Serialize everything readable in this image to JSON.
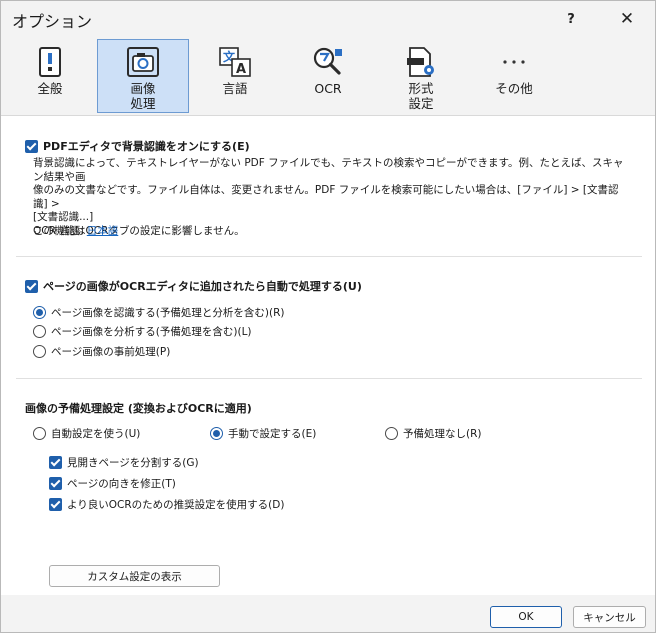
{
  "window": {
    "title": "オプション",
    "help_label": "?",
    "close_label": "✕"
  },
  "toolbar": {
    "items": [
      {
        "label": "全般",
        "icon": "general-settings-icon"
      },
      {
        "label": "画像\n処理",
        "icon": "image-processing-icon"
      },
      {
        "label": "言語",
        "icon": "language-icon"
      },
      {
        "label": "OCR",
        "icon": "ocr-icon"
      },
      {
        "label": "形式\n設定",
        "icon": "format-settings-icon"
      },
      {
        "label": "その他",
        "icon": "more-icon"
      }
    ],
    "selected_index": 1
  },
  "background_recognition": {
    "label": "PDFエディタで背景認識をオンにする(E)",
    "checked": true,
    "description_line1": "背景認識によって、テキストレイヤーがない PDF ファイルでも、テキストの検索やコピーができます。例、たとえば、スキャン結果や画",
    "description_line2": "像のみの文書などです。ファイル自体は、変更されません。PDF ファイルを検索可能にしたい場合は、[ファイル] > [文書認識] >",
    "description_line3": "[文書認識...]",
    "description_line4": "この機能はOCRタブの設定に影響しません。",
    "ocr_language_label": "OCR 言語:",
    "ocr_language_value": "日本語"
  },
  "auto_process": {
    "label": "ページの画像がOCRエディタに追加されたら自動で処理する(U)",
    "checked": true,
    "options": [
      {
        "label": "ページ画像を認識する(予備処理と分析を含む)(R)",
        "selected": true
      },
      {
        "label": "ページ画像を分析する(予備処理を含む)(L)",
        "selected": false
      },
      {
        "label": "ページ画像の事前処理(P)",
        "selected": false
      }
    ]
  },
  "preprocessing": {
    "heading": "画像の予備処理設定 (変換およびOCRに適用)",
    "modes": [
      {
        "label": "自動設定を使う(U)",
        "selected": false
      },
      {
        "label": "手動で設定する(E)",
        "selected": true
      },
      {
        "label": "予備処理なし(R)",
        "selected": false
      }
    ],
    "checks": [
      {
        "label": "見開きページを分割する(G)",
        "checked": true
      },
      {
        "label": "ページの向きを修正(T)",
        "checked": true
      },
      {
        "label": "より良いOCRのための推奨設定を使用する(D)",
        "checked": true
      }
    ],
    "custom_button": "カスタム設定の表示"
  },
  "footer": {
    "ok_label": "OK",
    "cancel_label": "キャンセル"
  },
  "colors": {
    "accent": "#1f5fab",
    "selected_tab_bg": "#cde0f7",
    "link": "#1565c0"
  }
}
